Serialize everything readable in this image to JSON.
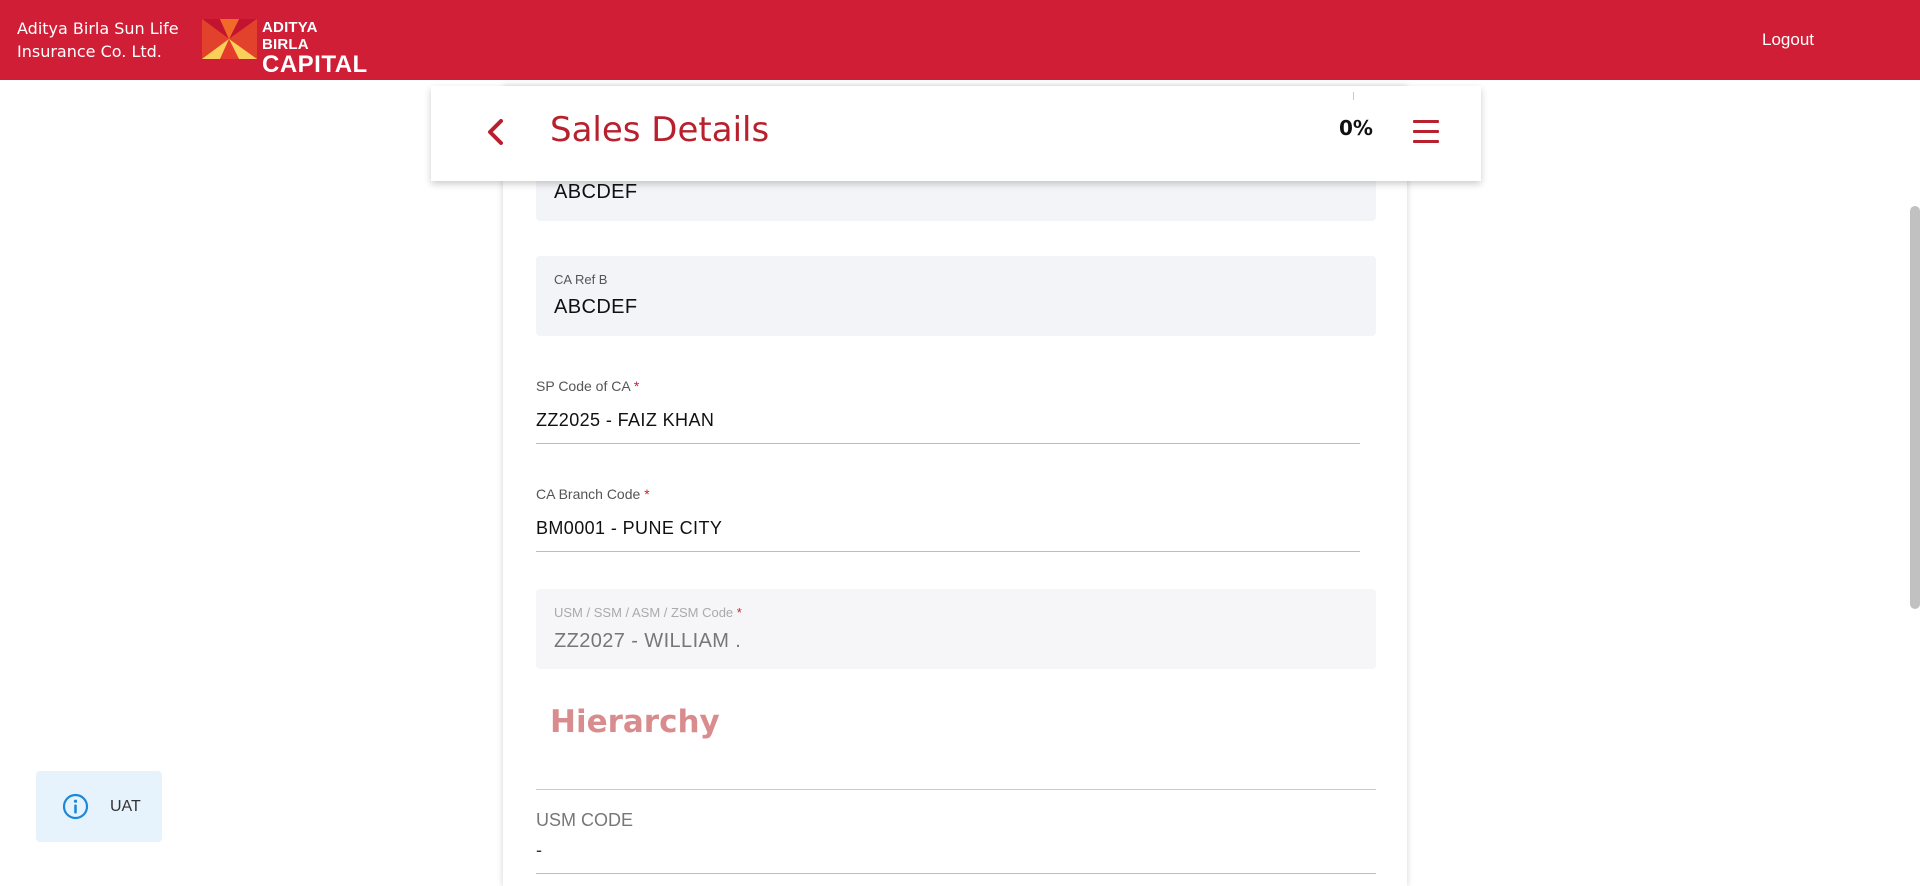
{
  "topbar": {
    "company_line1": "Aditya Birla Sun Life",
    "company_line2": "Insurance Co. Ltd.",
    "logo_line1": "ADITYA BIRLA",
    "logo_line2": "CAPITAL",
    "logout_label": "Logout",
    "color": "#cf1e36"
  },
  "header": {
    "title": "Sales Details",
    "progress": "0%",
    "back_icon": "chevron-left-icon",
    "menu_icon": "hamburger-menu-icon"
  },
  "fields": {
    "ca_ref_a": {
      "value": "ABCDEF"
    },
    "ca_ref_b": {
      "label": "CA Ref B",
      "value": "ABCDEF"
    },
    "sp_code": {
      "label": "SP Code of CA",
      "required": "*",
      "value": "ZZ2025 - FAIZ  KHAN"
    },
    "branch_code": {
      "label": "CA Branch Code",
      "required": "*",
      "value": "BM0001 - PUNE CITY"
    },
    "usm_code_field": {
      "label": "USM / SSM / ASM / ZSM Code",
      "required": "*",
      "value": "ZZ2027 - WILLIAM  ."
    }
  },
  "hierarchy": {
    "title": "Hierarchy",
    "usm_label": "USM CODE",
    "usm_value": "-"
  },
  "env_badge": {
    "label": "UAT",
    "icon": "info-icon"
  }
}
